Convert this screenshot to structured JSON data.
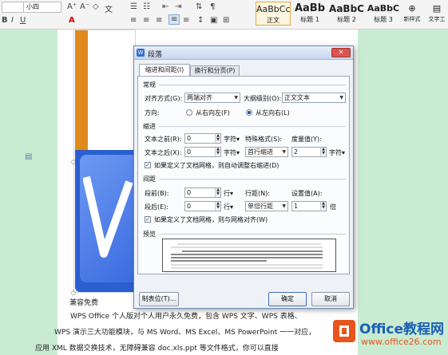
{
  "ribbon": {
    "font_name": "",
    "font_size": "小四",
    "grow_font": "A⁺",
    "shrink_font": "A⁻",
    "font_color_sample": "A",
    "bold": "B",
    "italic": "I",
    "underline": "U",
    "styles": [
      {
        "preview": "AaBbCcI",
        "caption": "正文"
      },
      {
        "preview": "AaBb",
        "caption": "标题 1"
      },
      {
        "preview": "AaBbC",
        "caption": "标题 2"
      },
      {
        "preview": "AaBbC",
        "caption": "标题 3"
      }
    ],
    "new_style": "新样式",
    "text_tools": "文字工"
  },
  "document": {
    "caption": "兼容免费",
    "para1_line1": "WPS Office 个人版对个人用户永久免费，包含 WPS 文字、WPS 表格、",
    "para1_line2": "WPS 演示三大功能模块，与 MS Word、MS Excel、MS PowerPoint 一一对应，",
    "para1_line3": "应用 XML 数据交换技术，无障碍兼容 doc.xls.ppt 等文件格式，你可以直接"
  },
  "dialog": {
    "title": "段落",
    "tabs": [
      "缩进和间距(I)",
      "换行和分页(P)"
    ],
    "general": {
      "section": "常规",
      "align_label": "对齐方式(G):",
      "align_value": "两端对齐",
      "outline_label": "大纲级别(O):",
      "outline_value": "正文文本",
      "direction_label": "方向:",
      "rtl_label": "从右向左(F)",
      "ltr_label": "从左向右(L)"
    },
    "indent": {
      "section": "缩进",
      "before_label": "文本之前(R):",
      "before_value": "0",
      "before_unit": "字符▾",
      "after_label": "文本之后(X):",
      "after_value": "0",
      "after_unit": "字符▾",
      "special_label": "特殊格式(S):",
      "special_value": "首行缩进",
      "measure_label": "度量值(Y):",
      "measure_value": "2",
      "measure_unit": "字符▾",
      "grid_check": "如果定义了文档网格，则自动调整右缩进(D)"
    },
    "spacing": {
      "section": "间距",
      "before_label": "段前(B):",
      "before_value": "0",
      "before_unit": "行▾",
      "after_label": "段后(E):",
      "after_value": "0",
      "after_unit": "行▾",
      "line_label": "行距(N):",
      "line_value": "单倍行距",
      "setting_label": "设置值(A):",
      "setting_value": "1",
      "setting_unit": "倍",
      "grid_check": "如果定义了文档网格，则与网格对齐(W)"
    },
    "preview_section": "预览",
    "tabs_button": "制表位(T)...",
    "ok_button": "确定",
    "cancel_button": "取消"
  },
  "watermark": {
    "brand": "Office教程网",
    "url": "www.office26.com"
  }
}
